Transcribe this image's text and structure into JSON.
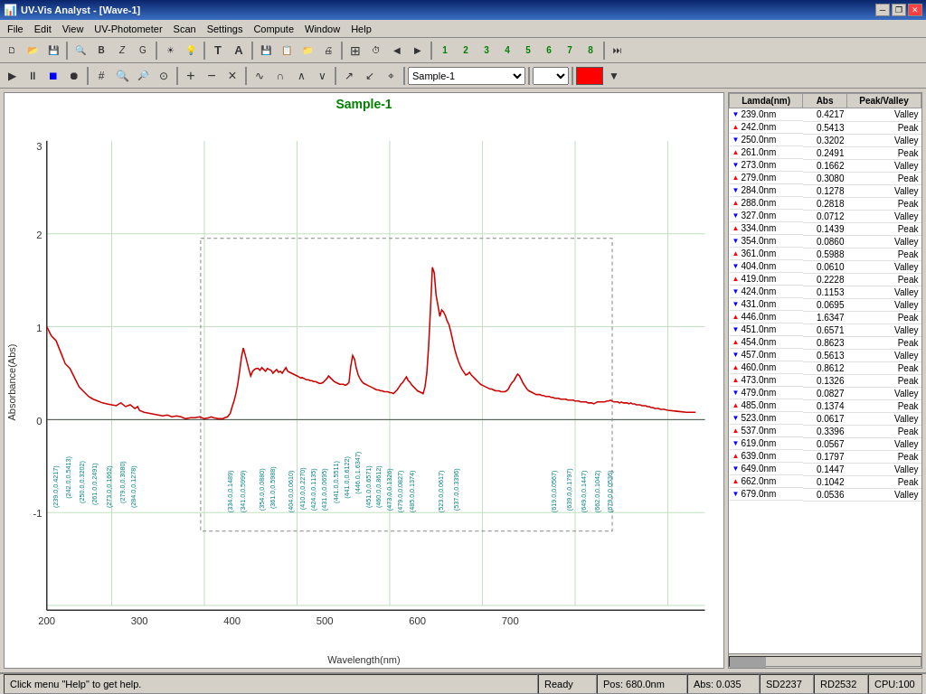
{
  "window": {
    "title": "UV-Vis Analyst - [Wave-1]",
    "icon": "uv-vis-icon"
  },
  "titlebar": {
    "title": "UV-Vis Analyst - [Wave-1]",
    "minimize_label": "─",
    "restore_label": "❐",
    "close_label": "✕"
  },
  "menubar": {
    "items": [
      {
        "id": "file",
        "label": "File"
      },
      {
        "id": "edit",
        "label": "Edit"
      },
      {
        "id": "view",
        "label": "View"
      },
      {
        "id": "uv-photometer",
        "label": "UV-Photometer"
      },
      {
        "id": "scan",
        "label": "Scan"
      },
      {
        "id": "settings",
        "label": "Settings"
      },
      {
        "id": "compute",
        "label": "Compute"
      },
      {
        "id": "window",
        "label": "Window"
      },
      {
        "id": "help",
        "label": "Help"
      }
    ]
  },
  "toolbar1": {
    "buttons": [
      {
        "id": "new",
        "icon": "📄",
        "tooltip": "New"
      },
      {
        "id": "open",
        "icon": "📂",
        "tooltip": "Open"
      },
      {
        "id": "save",
        "icon": "💾",
        "tooltip": "Save"
      },
      {
        "id": "print",
        "icon": "🖨",
        "tooltip": "Print"
      },
      {
        "id": "bold",
        "icon": "B",
        "tooltip": "Bold"
      },
      {
        "id": "italic",
        "icon": "Z",
        "tooltip": "Italic"
      },
      {
        "id": "format",
        "icon": "G",
        "tooltip": "Format"
      },
      {
        "id": "light",
        "icon": "☀",
        "tooltip": "Light"
      },
      {
        "id": "dark",
        "icon": "🌙",
        "tooltip": "Dark"
      },
      {
        "id": "text-T",
        "icon": "T",
        "tooltip": "Text"
      },
      {
        "id": "text-A",
        "icon": "A",
        "tooltip": "Text Style"
      },
      {
        "id": "floppy",
        "icon": "💾",
        "tooltip": "Save As"
      },
      {
        "id": "copy",
        "icon": "📋",
        "tooltip": "Copy"
      },
      {
        "id": "folder2",
        "icon": "📁",
        "tooltip": "Open Folder"
      },
      {
        "id": "print2",
        "icon": "🖨",
        "tooltip": "Print Preview"
      },
      {
        "id": "grid",
        "icon": "⊞",
        "tooltip": "Grid"
      },
      {
        "id": "clock",
        "icon": "⏱",
        "tooltip": "Timer"
      },
      {
        "id": "left",
        "icon": "◀",
        "tooltip": "Left"
      },
      {
        "id": "right",
        "icon": "▶",
        "tooltip": "Right"
      },
      {
        "id": "b1",
        "icon": "1",
        "tooltip": "1"
      },
      {
        "id": "b2",
        "icon": "2",
        "tooltip": "2"
      },
      {
        "id": "b3",
        "icon": "3",
        "tooltip": "3"
      },
      {
        "id": "b4",
        "icon": "4",
        "tooltip": "4"
      },
      {
        "id": "b5",
        "icon": "5",
        "tooltip": "5"
      },
      {
        "id": "b6",
        "icon": "6",
        "tooltip": "6"
      },
      {
        "id": "b7",
        "icon": "7",
        "tooltip": "7"
      },
      {
        "id": "b8",
        "icon": "8",
        "tooltip": "8"
      },
      {
        "id": "arrow-right",
        "icon": "▶▶",
        "tooltip": "Next"
      }
    ]
  },
  "toolbar2": {
    "play_label": "▶",
    "pause_label": "⏸",
    "stop_label": "⏹",
    "rec_label": "⏺",
    "grid_label": "#",
    "zoom_in_label": "🔍",
    "zoom_out_label": "🔍",
    "zoom3_label": "🔍",
    "plus_label": "+",
    "minus_label": "−",
    "cross_label": "×",
    "wave1_label": "∿",
    "wave2_label": "∩",
    "wave3_label": "∧",
    "wave4_label": "∨",
    "cursor1_label": "↗",
    "cursor2_label": "↙",
    "cursor3_label": "⌖",
    "sample_value": "Sample-1",
    "sample_placeholder": "Sample-1",
    "color_label": ""
  },
  "chart": {
    "title": "Sample-1",
    "x_label": "Wavelength(nm)",
    "y_label": "Absorbance(Abs)",
    "x_min": 200,
    "x_max": 700,
    "y_min": -1,
    "y_max": 3,
    "grid_color": "#c0e0c0",
    "line_color": "#cc0000"
  },
  "data_table": {
    "headers": [
      "Lamda(nm)",
      "Abs",
      "Peak/Valley"
    ],
    "rows": [
      {
        "lambda": "239.0nm",
        "abs": "0.4217",
        "type": "Valley"
      },
      {
        "lambda": "242.0nm",
        "abs": "0.5413",
        "type": "Peak"
      },
      {
        "lambda": "250.0nm",
        "abs": "0.3202",
        "type": "Valley"
      },
      {
        "lambda": "261.0nm",
        "abs": "0.2491",
        "type": "Peak"
      },
      {
        "lambda": "273.0nm",
        "abs": "0.1662",
        "type": "Valley"
      },
      {
        "lambda": "279.0nm",
        "abs": "0.3080",
        "type": "Peak"
      },
      {
        "lambda": "284.0nm",
        "abs": "0.1278",
        "type": "Valley"
      },
      {
        "lambda": "288.0nm",
        "abs": "0.2818",
        "type": "Peak"
      },
      {
        "lambda": "327.0nm",
        "abs": "0.0712",
        "type": "Valley"
      },
      {
        "lambda": "334.0nm",
        "abs": "0.1439",
        "type": "Peak"
      },
      {
        "lambda": "354.0nm",
        "abs": "0.0860",
        "type": "Valley"
      },
      {
        "lambda": "361.0nm",
        "abs": "0.5988",
        "type": "Peak"
      },
      {
        "lambda": "404.0nm",
        "abs": "0.0610",
        "type": "Valley"
      },
      {
        "lambda": "419.0nm",
        "abs": "0.2228",
        "type": "Peak"
      },
      {
        "lambda": "424.0nm",
        "abs": "0.1153",
        "type": "Valley"
      },
      {
        "lambda": "431.0nm",
        "abs": "0.0695",
        "type": "Valley"
      },
      {
        "lambda": "446.0nm",
        "abs": "1.6347",
        "type": "Peak"
      },
      {
        "lambda": "451.0nm",
        "abs": "0.6571",
        "type": "Valley"
      },
      {
        "lambda": "454.0nm",
        "abs": "0.8623",
        "type": "Peak"
      },
      {
        "lambda": "457.0nm",
        "abs": "0.5613",
        "type": "Valley"
      },
      {
        "lambda": "460.0nm",
        "abs": "0.8612",
        "type": "Peak"
      },
      {
        "lambda": "473.0nm",
        "abs": "0.1326",
        "type": "Peak"
      },
      {
        "lambda": "479.0nm",
        "abs": "0.0827",
        "type": "Valley"
      },
      {
        "lambda": "485.0nm",
        "abs": "0.1374",
        "type": "Peak"
      },
      {
        "lambda": "523.0nm",
        "abs": "0.0617",
        "type": "Valley"
      },
      {
        "lambda": "537.0nm",
        "abs": "0.3396",
        "type": "Peak"
      },
      {
        "lambda": "619.0nm",
        "abs": "0.0567",
        "type": "Valley"
      },
      {
        "lambda": "639.0nm",
        "abs": "0.1797",
        "type": "Peak"
      },
      {
        "lambda": "649.0nm",
        "abs": "0.1447",
        "type": "Valley"
      },
      {
        "lambda": "662.0nm",
        "abs": "0.1042",
        "type": "Peak"
      },
      {
        "lambda": "679.0nm",
        "abs": "0.0536",
        "type": "Valley"
      }
    ]
  },
  "statusbar": {
    "help_text": "Click menu \"Help\" to get help.",
    "ready_text": "Ready",
    "pos_text": "Pos: 680.0nm",
    "abs_text": "Abs: 0.035",
    "sd_text": "SD2237",
    "rd_text": "RD2532",
    "cpu_text": "CPU:100"
  }
}
